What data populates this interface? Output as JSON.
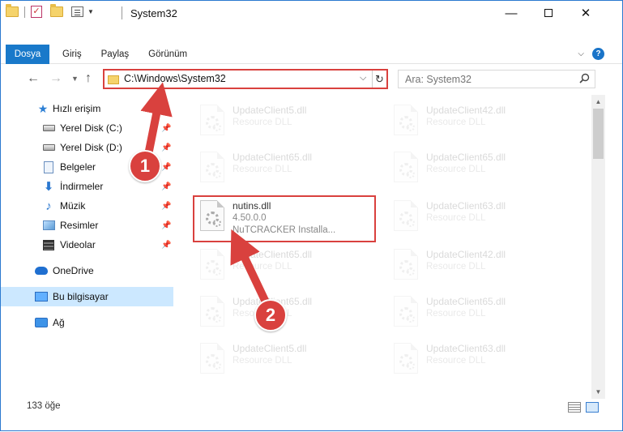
{
  "window": {
    "title": "System32"
  },
  "ribbon": {
    "tabs": [
      {
        "label": "Dosya"
      },
      {
        "label": "Giriş"
      },
      {
        "label": "Paylaş"
      },
      {
        "label": "Görünüm"
      }
    ],
    "help": "?"
  },
  "address": {
    "path": "C:\\Windows\\System32",
    "search_placeholder": "Ara: System32"
  },
  "sidebar": {
    "items": [
      {
        "label": "Hızlı erişim",
        "icon": "star-icon"
      },
      {
        "label": "Yerel Disk (C:)",
        "icon": "disk-icon"
      },
      {
        "label": "Yerel Disk (D:)",
        "icon": "disk-icon"
      },
      {
        "label": "Belgeler",
        "icon": "document-icon"
      },
      {
        "label": "İndirmeler",
        "icon": "download-icon"
      },
      {
        "label": "Müzik",
        "icon": "music-icon"
      },
      {
        "label": "Resimler",
        "icon": "pictures-icon"
      },
      {
        "label": "Videolar",
        "icon": "video-icon"
      },
      {
        "label": "OneDrive",
        "icon": "cloud-icon"
      },
      {
        "label": "Bu bilgisayar",
        "icon": "computer-icon"
      },
      {
        "label": "Ağ",
        "icon": "network-icon"
      }
    ]
  },
  "files": {
    "left": [
      {
        "name": "UpdateClient5.dll",
        "desc": "Resource DLL"
      },
      {
        "name": "UpdateClient65.dll",
        "desc": "Resource DLL"
      },
      {
        "name": "nutins.dll",
        "version": "4.50.0.0",
        "desc": "NuTCRACKER Installa..."
      },
      {
        "name": "UpdateClient65.dll",
        "desc": "Resource DLL"
      },
      {
        "name": "UpdateClient65.dll",
        "desc": "Resource DLL"
      },
      {
        "name": "UpdateClient5.dll",
        "desc": "Resource DLL"
      }
    ],
    "right": [
      {
        "name": "UpdateClient42.dll",
        "desc": "Resource DLL"
      },
      {
        "name": "UpdateClient65.dll",
        "desc": "Resource DLL"
      },
      {
        "name": "UpdateClient63.dll",
        "desc": "Resource DLL"
      },
      {
        "name": "UpdateClient42.dll",
        "desc": "Resource DLL"
      },
      {
        "name": "UpdateClient65.dll",
        "desc": "Resource DLL"
      },
      {
        "name": "UpdateClient63.dll",
        "desc": "Resource DLL"
      }
    ]
  },
  "status": {
    "count": "133 öğe"
  },
  "annotations": {
    "step1": "1",
    "step2": "2",
    "color": "#d9413e"
  }
}
